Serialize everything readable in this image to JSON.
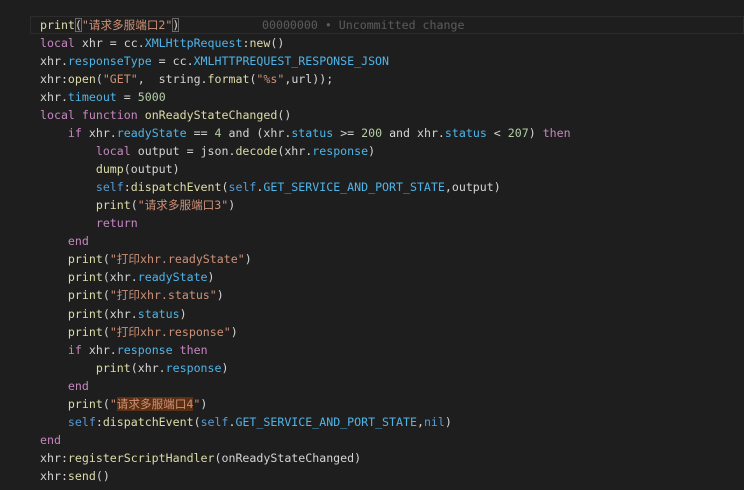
{
  "blame": "00000000 • Uncommitted change",
  "lines": [
    {
      "indent": 0,
      "tokens": [
        [
          "print",
          "f"
        ],
        [
          "(",
          "b"
        ],
        [
          "\"请求多服端口2\"",
          "s"
        ],
        [
          ")",
          "b"
        ]
      ]
    },
    {
      "indent": 0,
      "tokens": [
        [
          "local",
          "k"
        ],
        [
          " xhr = cc.",
          "v"
        ],
        [
          "XMLHttpRequest",
          "p"
        ],
        [
          ":",
          "v"
        ],
        [
          "new",
          "f"
        ],
        [
          "()",
          "v"
        ]
      ]
    },
    {
      "indent": 0,
      "tokens": [
        [
          "xhr.",
          "v"
        ],
        [
          "responseType",
          "p"
        ],
        [
          " = cc.",
          "v"
        ],
        [
          "XMLHTTPREQUEST_RESPONSE_JSON",
          "p"
        ]
      ]
    },
    {
      "indent": 0,
      "tokens": [
        [
          "xhr:",
          "v"
        ],
        [
          "open",
          "f"
        ],
        [
          "(",
          "v"
        ],
        [
          "\"GET\"",
          "s"
        ],
        [
          ",  string.",
          "v"
        ],
        [
          "format",
          "f"
        ],
        [
          "(",
          "v"
        ],
        [
          "\"%s\"",
          "s"
        ],
        [
          ",url));",
          "v"
        ]
      ]
    },
    {
      "indent": 0,
      "tokens": [
        [
          "xhr.",
          "v"
        ],
        [
          "timeout",
          "p"
        ],
        [
          " = ",
          "v"
        ],
        [
          "5000",
          "n"
        ]
      ]
    },
    {
      "indent": 0,
      "tokens": [
        [
          "local",
          "k"
        ],
        [
          " ",
          "v"
        ],
        [
          "function",
          "k"
        ],
        [
          " ",
          "v"
        ],
        [
          "onReadyStateChanged",
          "f"
        ],
        [
          "()",
          "v"
        ]
      ]
    },
    {
      "indent": 1,
      "tokens": [
        [
          "if",
          "k"
        ],
        [
          " xhr.",
          "v"
        ],
        [
          "readyState",
          "p"
        ],
        [
          " == ",
          "v"
        ],
        [
          "4",
          "n"
        ],
        [
          " and (xhr.",
          "v"
        ],
        [
          "status",
          "p"
        ],
        [
          " >= ",
          "v"
        ],
        [
          "200",
          "n"
        ],
        [
          " and xhr.",
          "v"
        ],
        [
          "status",
          "p"
        ],
        [
          " < ",
          "v"
        ],
        [
          "207",
          "n"
        ],
        [
          ") ",
          "v"
        ],
        [
          "then",
          "k"
        ]
      ]
    },
    {
      "indent": 2,
      "tokens": [
        [
          "local",
          "k"
        ],
        [
          " output = json.",
          "v"
        ],
        [
          "decode",
          "f"
        ],
        [
          "(xhr.",
          "v"
        ],
        [
          "response",
          "p"
        ],
        [
          ")",
          "v"
        ]
      ]
    },
    {
      "indent": 2,
      "tokens": [
        [
          "dump",
          "f"
        ],
        [
          "(output)",
          "v"
        ]
      ]
    },
    {
      "indent": 2,
      "tokens": [
        [
          "self",
          "c"
        ],
        [
          ":",
          "v"
        ],
        [
          "dispatchEvent",
          "f"
        ],
        [
          "(",
          "v"
        ],
        [
          "self",
          "c"
        ],
        [
          ".",
          "v"
        ],
        [
          "GET_SERVICE_AND_PORT_STATE",
          "p"
        ],
        [
          ",output)",
          "v"
        ]
      ]
    },
    {
      "indent": 2,
      "tokens": [
        [
          "print",
          "f"
        ],
        [
          "(",
          "v"
        ],
        [
          "\"请求多服端口3\"",
          "s"
        ],
        [
          ")",
          "v"
        ]
      ]
    },
    {
      "indent": 2,
      "tokens": [
        [
          "return",
          "k"
        ]
      ]
    },
    {
      "indent": 1,
      "tokens": [
        [
          "end",
          "k"
        ]
      ]
    },
    {
      "indent": 1,
      "tokens": [
        [
          "print",
          "f"
        ],
        [
          "(",
          "v"
        ],
        [
          "\"打印xhr.readyState\"",
          "s"
        ],
        [
          ")",
          "v"
        ]
      ]
    },
    {
      "indent": 1,
      "tokens": [
        [
          "print",
          "f"
        ],
        [
          "(xhr.",
          "v"
        ],
        [
          "readyState",
          "p"
        ],
        [
          ")",
          "v"
        ]
      ]
    },
    {
      "indent": 1,
      "tokens": [
        [
          "print",
          "f"
        ],
        [
          "(",
          "v"
        ],
        [
          "\"打印xhr.status\"",
          "s"
        ],
        [
          ")",
          "v"
        ]
      ]
    },
    {
      "indent": 1,
      "tokens": [
        [
          "print",
          "f"
        ],
        [
          "(xhr.",
          "v"
        ],
        [
          "status",
          "p"
        ],
        [
          ")",
          "v"
        ]
      ]
    },
    {
      "indent": 1,
      "tokens": [
        [
          "print",
          "f"
        ],
        [
          "(",
          "v"
        ],
        [
          "\"打印xhr.response\"",
          "s"
        ],
        [
          ")",
          "v"
        ]
      ]
    },
    {
      "indent": 1,
      "tokens": [
        [
          "if",
          "k"
        ],
        [
          " xhr.",
          "v"
        ],
        [
          "response",
          "p"
        ],
        [
          " ",
          "v"
        ],
        [
          "then",
          "k"
        ]
      ]
    },
    {
      "indent": 2,
      "tokens": [
        [
          "print",
          "f"
        ],
        [
          "(xhr.",
          "v"
        ],
        [
          "response",
          "p"
        ],
        [
          ")",
          "v"
        ]
      ]
    },
    {
      "indent": 1,
      "tokens": [
        [
          "end",
          "k"
        ]
      ]
    },
    {
      "indent": 1,
      "tokens": [
        [
          "print",
          "f"
        ],
        [
          "(",
          "v"
        ],
        [
          "\"",
          "s"
        ],
        [
          "请求多服端口4",
          "h"
        ],
        [
          "\"",
          "s"
        ],
        [
          ")",
          "v"
        ]
      ]
    },
    {
      "indent": 1,
      "tokens": [
        [
          "self",
          "c"
        ],
        [
          ":",
          "v"
        ],
        [
          "dispatchEvent",
          "f"
        ],
        [
          "(",
          "v"
        ],
        [
          "self",
          "c"
        ],
        [
          ".",
          "v"
        ],
        [
          "GET_SERVICE_AND_PORT_STATE",
          "p"
        ],
        [
          ",",
          "v"
        ],
        [
          "nil",
          "c"
        ],
        [
          ")",
          "v"
        ]
      ]
    },
    {
      "indent": 0,
      "tokens": [
        [
          "end",
          "k"
        ]
      ]
    },
    {
      "indent": 0,
      "tokens": [
        [
          "xhr:",
          "v"
        ],
        [
          "registerScriptHandler",
          "f"
        ],
        [
          "(onReadyStateChanged)",
          "v"
        ]
      ]
    },
    {
      "indent": 0,
      "tokens": [
        [
          "xhr:",
          "v"
        ],
        [
          "send",
          "f"
        ],
        [
          "()",
          "v"
        ]
      ]
    }
  ]
}
